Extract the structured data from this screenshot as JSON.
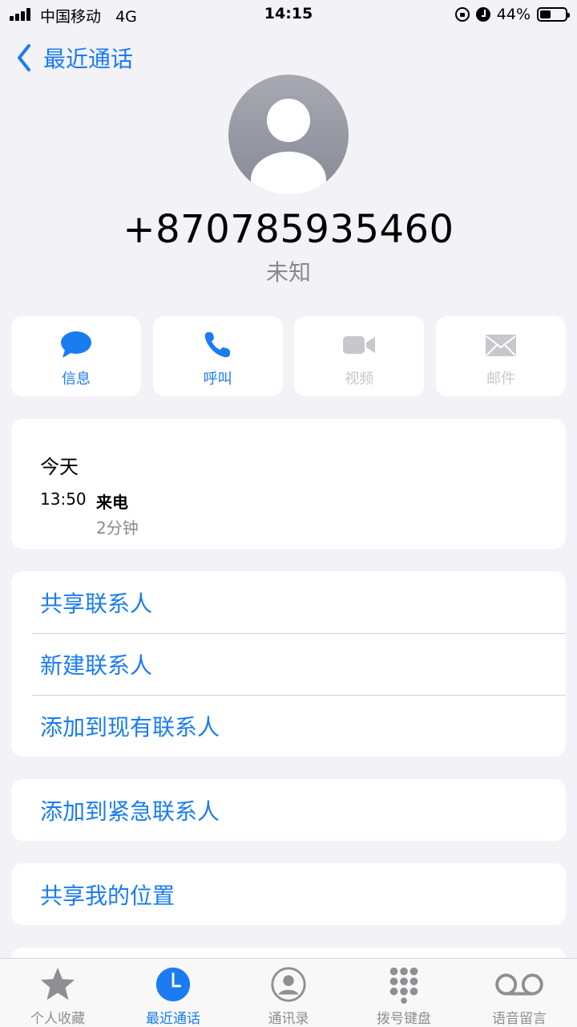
{
  "status_bar": {
    "carrier": "中国移动",
    "network": "4G",
    "time": "14:15",
    "battery_percent": "44%",
    "battery_level": 0.44
  },
  "nav": {
    "back_label": "最近通话"
  },
  "contact": {
    "number": "+870785935460",
    "label": "未知"
  },
  "actions": [
    {
      "label": "信息",
      "icon": "message-icon",
      "enabled": true
    },
    {
      "label": "呼叫",
      "icon": "phone-icon",
      "enabled": true
    },
    {
      "label": "视频",
      "icon": "video-icon",
      "enabled": false
    },
    {
      "label": "邮件",
      "icon": "mail-icon",
      "enabled": false
    }
  ],
  "call_log": {
    "day": "今天",
    "time": "13:50",
    "type": "来电",
    "duration": "2分钟"
  },
  "options": {
    "share_contact": "共享联系人",
    "new_contact": "新建联系人",
    "add_existing": "添加到现有联系人",
    "add_emergency": "添加到紧急联系人",
    "share_location": "共享我的位置"
  },
  "tabs": [
    {
      "label": "个人收藏",
      "icon": "star-icon"
    },
    {
      "label": "最近通话",
      "icon": "clock-icon",
      "active": true
    },
    {
      "label": "通讯录",
      "icon": "contacts-icon"
    },
    {
      "label": "拨号键盘",
      "icon": "keypad-icon"
    },
    {
      "label": "语音留言",
      "icon": "voicemail-icon"
    }
  ],
  "colors": {
    "accent": "#1a7cf0",
    "background": "#f2f2f7",
    "disabled": "#c7c7cc",
    "secondary_text": "#8a8a8e"
  }
}
